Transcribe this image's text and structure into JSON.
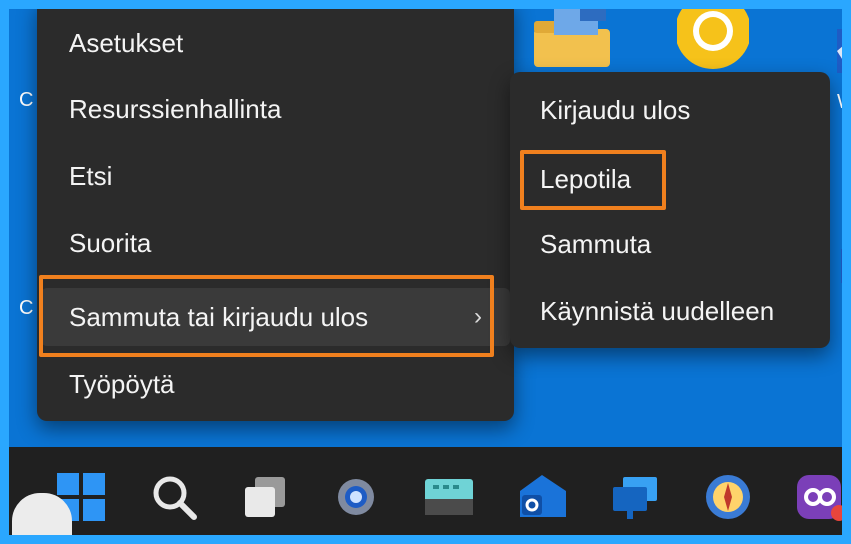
{
  "menu": {
    "items": [
      {
        "label": "Asetukset"
      },
      {
        "label": "Resurssienhallinta"
      },
      {
        "label": "Etsi"
      },
      {
        "label": "Suorita"
      },
      {
        "label": "Sammuta tai kirjaudu ulos",
        "chevron": "›"
      },
      {
        "label": "Työpöytä"
      }
    ]
  },
  "submenu": {
    "items": [
      {
        "label": "Kirjaudu ulos"
      },
      {
        "label": "Lepotila"
      },
      {
        "label": "Sammuta"
      },
      {
        "label": "Käynnistä uudelleen"
      }
    ]
  },
  "desktop": {
    "partial_left_letter_1": "C",
    "partial_left_letter_2": "C",
    "partial_right_letter": "W"
  },
  "taskbar": {
    "icons": [
      "windows-start-icon",
      "search-icon",
      "task-view-icon",
      "settings-gear-icon",
      "keyboard-icon",
      "outlook-icon",
      "remote-desktop-icon",
      "compass-icon",
      "clipchamp-icon"
    ]
  },
  "colors": {
    "accent_outline": "#f0801e",
    "menu_bg": "#2b2b2b",
    "desktop_bg": "#0a74d4",
    "taskbar_bg": "#202020"
  }
}
